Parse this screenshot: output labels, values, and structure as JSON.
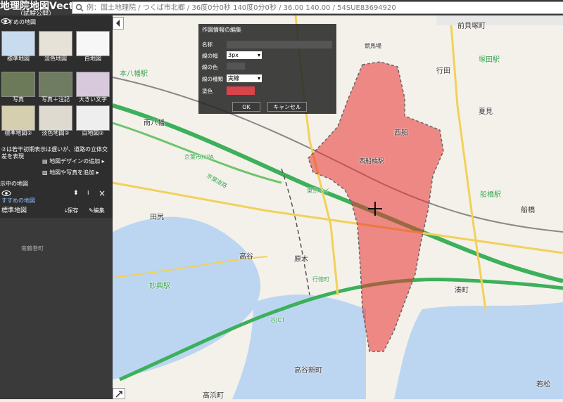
{
  "app": {
    "title": "地理院地図Vector",
    "subtitle": "（試験公開）"
  },
  "search": {
    "placeholder": "例：国土地理院 / つくば市北郷 / 36度0分0秒 140度0分0秒 / 36.00 140.00 / 54SUE83694920"
  },
  "sidebar": {
    "recommended_title": "すすめの地図",
    "thumbnails": [
      {
        "label": "標準地図",
        "color": "#c9dcef"
      },
      {
        "label": "淡色地図",
        "color": "#e6e2d8"
      },
      {
        "label": "白地図",
        "color": "#f7f7f7"
      },
      {
        "label": "写真",
        "color": "#6c7a5a"
      },
      {
        "label": "写真＋注記",
        "color": "#6f7c61"
      },
      {
        "label": "大きい文字",
        "color": "#d8c9dd"
      },
      {
        "label": "標準地図②",
        "color": "#d5cfb0"
      },
      {
        "label": "淡色地図②",
        "color": "#dedad0"
      },
      {
        "label": "白地図②",
        "color": "#eeeeee"
      }
    ],
    "note": "②は若干初期表示は遅いが、道路の立体交差を表現",
    "menu": [
      {
        "label": "地図デザインの追加"
      },
      {
        "label": "地図や写真を追加"
      }
    ],
    "displayed_title": "示中の地図",
    "displayed_item_title": "すすめの地図",
    "displayed_item_name": "標準地図",
    "save_label": "保存",
    "edit_label": "編集",
    "close_icon": "×",
    "info_icon": "ⅰ",
    "dark_map_label": "南鶴巻町"
  },
  "dialog": {
    "title": "作図情報の編集",
    "name_label": "名称",
    "line_width_label": "線の幅",
    "line_width_value": "3px",
    "line_color_label": "線の色",
    "line_type_label": "線の種類",
    "line_type_value": "実線",
    "fill_label": "塗色",
    "ok_label": "OK",
    "cancel_label": "キャンセル"
  },
  "map": {
    "labels": {
      "maebara": "前貝塚町",
      "tsukada": "塚田駅",
      "sasamebori": "競馬場",
      "gyoden": "行田",
      "motohachiman": "本八幡駅",
      "natsumi": "夏見",
      "minamihachiman": "南八幡",
      "nishifuna": "西船",
      "nishifunabashi": "西船橋駅",
      "funabashi": "船橋駅",
      "funabashi2": "船橋",
      "taji": "田尻",
      "takaya": "高谷",
      "haraki": "原木",
      "minato": "湊町",
      "myoden": "妙典駅",
      "takayashinmachi": "高谷新町",
      "takahamacho": "高浜町",
      "wakamatsu": "若松",
      "jct": "谷JCT",
      "road1": "京葉道路",
      "road2": "京葉市川PA",
      "road3": "行徳町",
      "road4": "東京ベイ"
    }
  }
}
